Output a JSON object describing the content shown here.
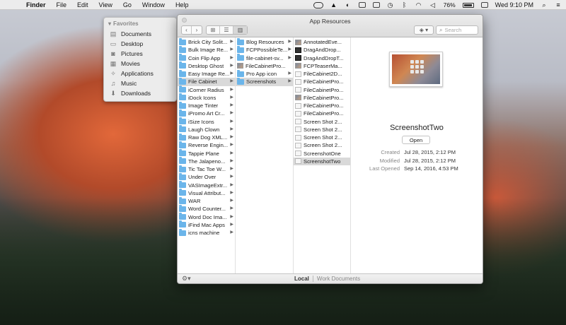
{
  "menubar": {
    "apple_glyph": "",
    "app_name": "Finder",
    "menus": [
      "File",
      "Edit",
      "View",
      "Go",
      "Window",
      "Help"
    ],
    "battery": "76%",
    "clock": "Wed 9:10 PM"
  },
  "sidebar": {
    "section": "Favorites",
    "items": [
      {
        "label": "Documents",
        "icon": "documents-icon"
      },
      {
        "label": "Desktop",
        "icon": "desktop-icon"
      },
      {
        "label": "Pictures",
        "icon": "pictures-icon"
      },
      {
        "label": "Movies",
        "icon": "movies-icon"
      },
      {
        "label": "Applications",
        "icon": "applications-icon"
      },
      {
        "label": "Music",
        "icon": "music-icon"
      },
      {
        "label": "Downloads",
        "icon": "downloads-icon"
      }
    ]
  },
  "window": {
    "title": "App Resources",
    "search_placeholder": "Search",
    "columns": {
      "col1": [
        {
          "name": "Brick City Solit...",
          "type": "folder"
        },
        {
          "name": "Bulk Image Re...",
          "type": "folder"
        },
        {
          "name": "Coin Flip App",
          "type": "folder"
        },
        {
          "name": "Desktop Ghost",
          "type": "folder"
        },
        {
          "name": "Easy Image Re...",
          "type": "folder"
        },
        {
          "name": "File Cabinet",
          "type": "folder",
          "selected": true
        },
        {
          "name": "iCorner Radius",
          "type": "folder"
        },
        {
          "name": "iDock Icons",
          "type": "folder"
        },
        {
          "name": "Image Tinter",
          "type": "folder"
        },
        {
          "name": "iPromo Art Cr...",
          "type": "folder"
        },
        {
          "name": "iSize Icons",
          "type": "folder"
        },
        {
          "name": "Laugh Clown",
          "type": "folder"
        },
        {
          "name": "Raw Dog XML...",
          "type": "folder"
        },
        {
          "name": "Reverse Engin...",
          "type": "folder"
        },
        {
          "name": "Tappie Plane",
          "type": "folder"
        },
        {
          "name": "The Jalapeno...",
          "type": "folder"
        },
        {
          "name": "Tic Tac Toe W...",
          "type": "folder"
        },
        {
          "name": "Under Over",
          "type": "folder"
        },
        {
          "name": "VASImageExtr...",
          "type": "folder"
        },
        {
          "name": "Visual Attribut...",
          "type": "folder"
        },
        {
          "name": "WAR",
          "type": "folder"
        },
        {
          "name": "Word Counter...",
          "type": "folder"
        },
        {
          "name": "Word Doc Ima...",
          "type": "folder"
        },
        {
          "name": "iFind Mac Apps",
          "type": "folder"
        },
        {
          "name": "icns machine",
          "type": "folder"
        }
      ],
      "col2": [
        {
          "name": "Blog Resources",
          "type": "folder"
        },
        {
          "name": "FCPPossibleTe...",
          "type": "folder"
        },
        {
          "name": "file-cabinet-sv...",
          "type": "folder"
        },
        {
          "name": "FileCabinetPro...",
          "type": "image"
        },
        {
          "name": "Pro App icon",
          "type": "folder"
        },
        {
          "name": "Screenshots",
          "type": "folder",
          "selected": true
        }
      ],
      "col3": [
        {
          "name": "AnnotatedEve...",
          "type": "image"
        },
        {
          "name": "DragAndDrop...",
          "type": "image-dark"
        },
        {
          "name": "DragAndDropT...",
          "type": "image-dark"
        },
        {
          "name": "FCPTeaserMa...",
          "type": "image"
        },
        {
          "name": "FileCabinet2D...",
          "type": "doc"
        },
        {
          "name": "FileCabinetPro...",
          "type": "doc"
        },
        {
          "name": "FileCabinetPro...",
          "type": "doc"
        },
        {
          "name": "FileCabinetPro...",
          "type": "image"
        },
        {
          "name": "FileCabinetPro...",
          "type": "doc"
        },
        {
          "name": "FileCabinetPro...",
          "type": "doc"
        },
        {
          "name": "Screen Shot 2...",
          "type": "doc"
        },
        {
          "name": "Screen Shot 2...",
          "type": "doc"
        },
        {
          "name": "Screen Shot 2...",
          "type": "doc"
        },
        {
          "name": "Screen Shot 2...",
          "type": "doc"
        },
        {
          "name": "ScreenshotOne",
          "type": "doc"
        },
        {
          "name": "ScreenshotTwo",
          "type": "doc",
          "selected": true
        }
      ]
    },
    "preview": {
      "name": "ScreenshotTwo",
      "open_label": "Open",
      "meta": [
        {
          "label": "Created",
          "value": "Jul 28, 2015, 2:12 PM"
        },
        {
          "label": "Modified",
          "value": "Jul 28, 2015, 2:12 PM"
        },
        {
          "label": "Last Opened",
          "value": "Sep 14, 2016, 4:53 PM"
        }
      ]
    },
    "statusbar": {
      "tab_local": "Local",
      "tab_work": "Work Documents"
    }
  }
}
